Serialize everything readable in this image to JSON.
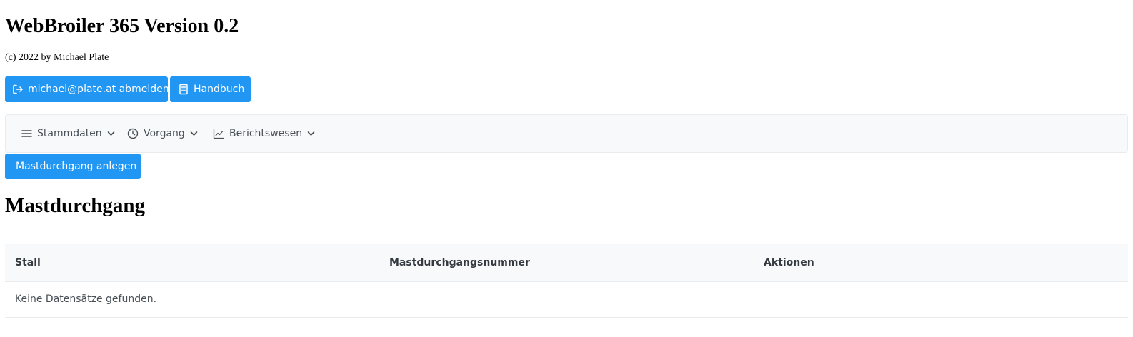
{
  "header": {
    "title": "WebBroiler 365 Version 0.2",
    "copyright": "(c) 2022 by Michael Plate"
  },
  "actions": {
    "logout_label": "michael@plate.at abmelden",
    "logout_icon": "sign-out-icon",
    "manual_label": "Handbuch",
    "manual_icon": "book-icon"
  },
  "menubar": {
    "items": [
      {
        "label": "Stammdaten",
        "icon": "bars-icon"
      },
      {
        "label": "Vorgang",
        "icon": "clock-icon"
      },
      {
        "label": "Berichtswesen",
        "icon": "chart-line-icon"
      }
    ]
  },
  "toolbar": {
    "create_label": "Mastdurchgang anlegen"
  },
  "main": {
    "title": "Mastdurchgang",
    "table": {
      "columns": [
        "Stall",
        "Mastdurchgangsnummer",
        "Aktionen"
      ],
      "empty_message": "Keine Datensätze gefunden."
    }
  },
  "colors": {
    "primary": "#2196f3",
    "menubar_bg": "#f8f9fa",
    "table_header_bg": "#f8f9fa",
    "text_muted": "#495057"
  }
}
